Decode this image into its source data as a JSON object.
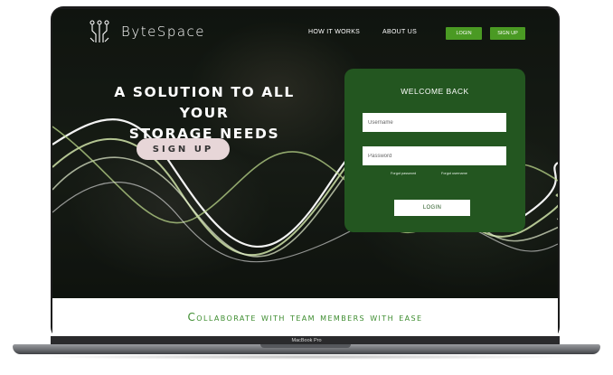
{
  "brand": {
    "name": "ByteSpace",
    "accent": "#4a9a23",
    "card_color": "#235620",
    "logo_icon": "circuit-icon"
  },
  "nav": {
    "how_it_works": "HOW IT WORKS",
    "about_us": "ABOUT US",
    "login": "LOGIN",
    "sign_up": "SIGN UP"
  },
  "hero": {
    "headline_line1": "A SOLUTION TO ALL YOUR",
    "headline_line2": "STORAGE NEEDS",
    "signup_button": "SIGN UP"
  },
  "login_card": {
    "title": "WELCOME BACK",
    "username_placeholder": "Username",
    "password_placeholder": "Password",
    "forgot_password": "Forgot password",
    "forgot_username": "Forgot username",
    "login_button": "LOGIN"
  },
  "tagline": "Collaborate with team members with ease",
  "device": {
    "model": "MacBook Pro"
  }
}
